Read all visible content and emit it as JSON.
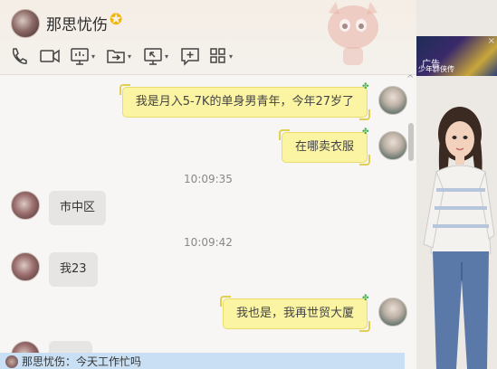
{
  "window": {
    "contact_name": "那思忧伤",
    "vip_icon": "star-icon",
    "controls": [
      "minimize-icon",
      "close-icon"
    ],
    "accent_color": "#f2b705"
  },
  "toolbar": {
    "icons": [
      "phone-icon",
      "video-icon",
      "screen-share-icon",
      "file-transfer-icon",
      "remote-desktop-icon",
      "message-icon",
      "apps-grid-icon"
    ]
  },
  "messages": [
    {
      "sender": "me",
      "text": "我是月入5-7K的单身男青年，今年27岁了"
    },
    {
      "sender": "me",
      "text": "在哪卖衣服"
    },
    {
      "type": "time",
      "text": "10:09:35"
    },
    {
      "sender": "them",
      "text": "市中区"
    },
    {
      "type": "time",
      "text": "10:09:42"
    },
    {
      "sender": "them",
      "text": "我23"
    },
    {
      "sender": "me",
      "text": "我也是，我再世贸大厦"
    },
    {
      "sender": "them",
      "text": ""
    }
  ],
  "notice": {
    "text": "那思忧伤：今天工作忙吗"
  },
  "ad": {
    "label": "广告",
    "subtitle": "少年群侠传",
    "close": "×"
  },
  "colors": {
    "my_bubble": "#fbf4a2",
    "their_bubble": "#e7e5e3",
    "notice_bar": "#c9dff3"
  }
}
